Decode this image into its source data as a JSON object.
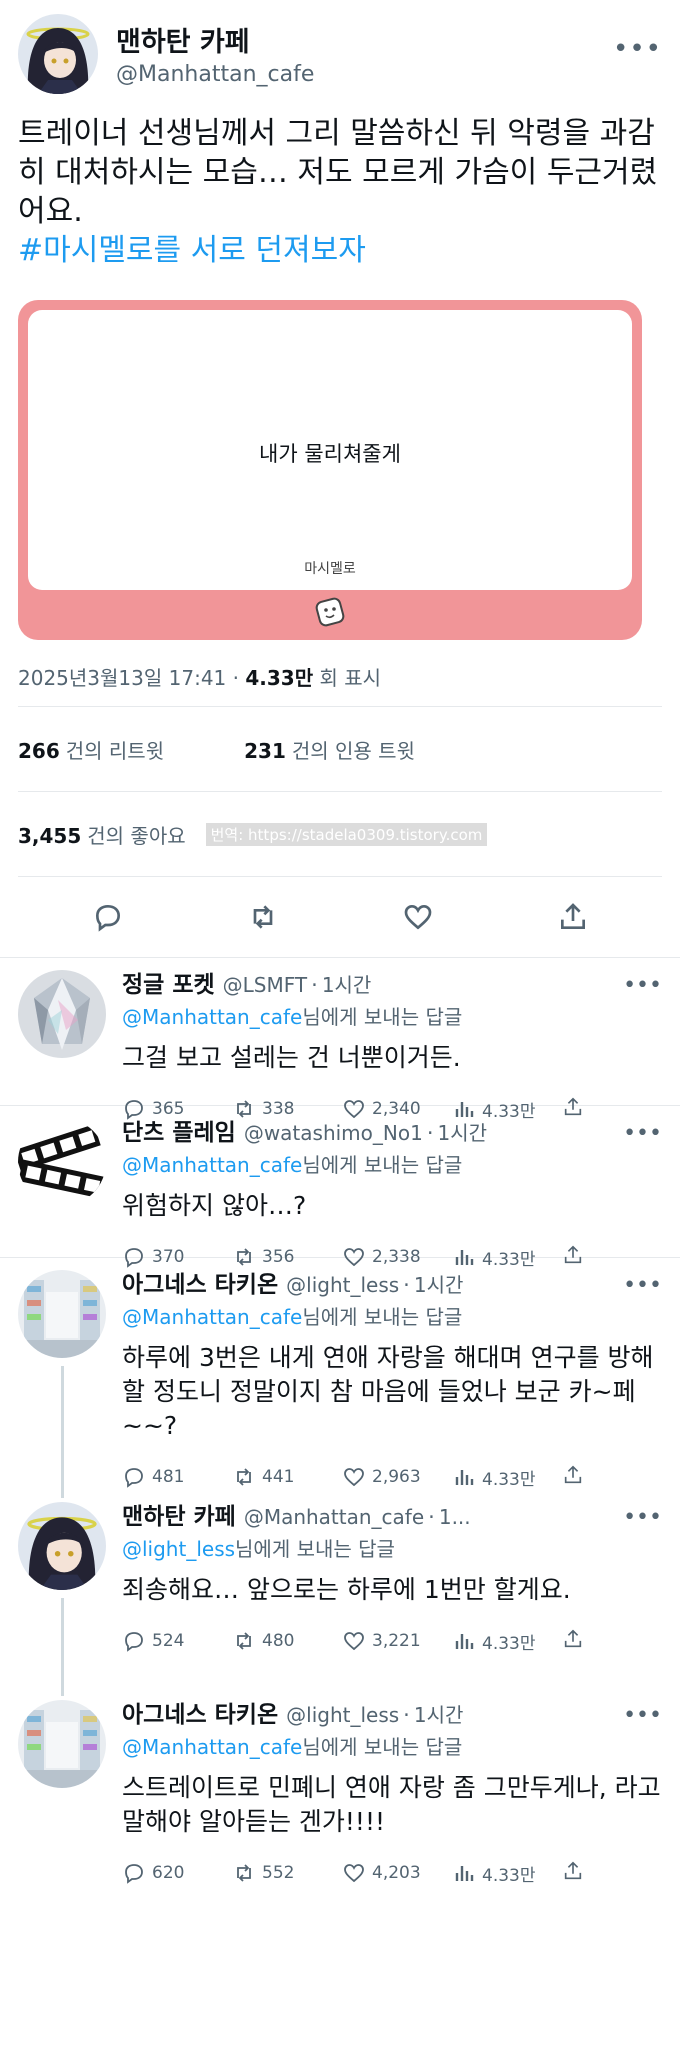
{
  "tweet": {
    "author_name": "맨하탄 카페",
    "author_handle": "@Manhattan_cafe",
    "text": "트레이너 선생님께서 그리 말씀하신 뒤 악령을 과감히 대처하시는 모습… 저도 모르게 가슴이 두근거렸어요.",
    "hashtag": "#마시멜로를 서로 던져보자",
    "card_message": "내가 물리쳐줄게",
    "card_label": "마시멜로",
    "timestamp": "2025년3월13일 17:41",
    "views": "4.33만",
    "views_label": "회 표시",
    "retweets": "266",
    "retweets_label": "건의 리트윗",
    "quotes": "231",
    "quotes_label": "건의 인용 트윗",
    "likes": "3,455",
    "likes_label": "건의 좋아요",
    "watermark": "번역: https://stadela0309.tistory.com"
  },
  "replies": [
    {
      "name": "정글 포켓",
      "handle": "@LSMFT",
      "time": "1시간",
      "to_mention": "@Manhattan_cafe",
      "to_suffix": "님에게 보내는 답글",
      "text": "그걸 보고 설레는 건 너뿐이거든.",
      "replies": "365",
      "retweets": "338",
      "likes": "2,340",
      "views": "4.33만"
    },
    {
      "name": "단츠 플레임",
      "handle": "@watashimo_No1",
      "time": "1시간",
      "to_mention": "@Manhattan_cafe",
      "to_suffix": "님에게 보내는 답글",
      "text": "위험하지 않아…?",
      "replies": "370",
      "retweets": "356",
      "likes": "2,338",
      "views": "4.33만"
    },
    {
      "name": "아그네스 타키온",
      "handle": "@light_less",
      "time": "1시간",
      "to_mention": "@Manhattan_cafe",
      "to_suffix": "님에게 보내는 답글",
      "text": "하루에 3번은 내게 연애 자랑을 해대며 연구를 방해할 정도니 정말이지 참 마음에 들었나 보군 카~페~~?",
      "replies": "481",
      "retweets": "441",
      "likes": "2,963",
      "views": "4.33만"
    },
    {
      "name": "맨하탄 카페",
      "handle": "@Manhattan_cafe",
      "time": "1...",
      "to_mention": "@light_less",
      "to_suffix": "님에게 보내는 답글",
      "text": "죄송해요… 앞으로는 하루에 1번만 할게요.",
      "replies": "524",
      "retweets": "480",
      "likes": "3,221",
      "views": "4.33만"
    },
    {
      "name": "아그네스 타키온",
      "handle": "@light_less",
      "time": "1시간",
      "to_mention": "@Manhattan_cafe",
      "to_suffix": "님에게 보내는 답글",
      "text": "스트레이트로 민폐니 연애 자랑 좀 그만두게나, 라고 말해야 알아듣는 겐가!!!!",
      "replies": "620",
      "retweets": "552",
      "likes": "4,203",
      "views": "4.33만"
    }
  ]
}
